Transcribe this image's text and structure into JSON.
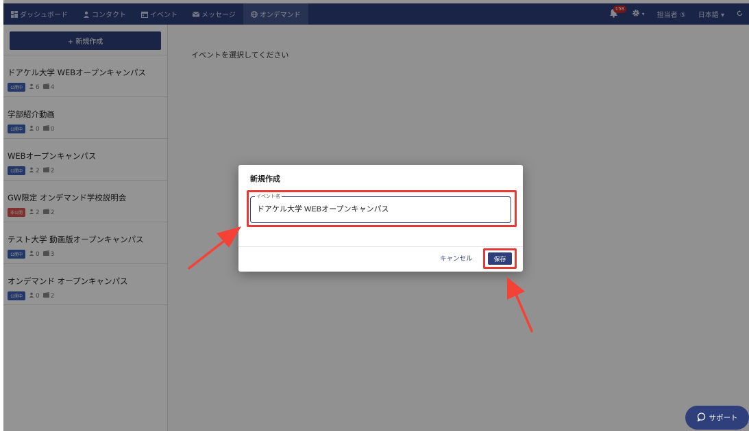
{
  "navbar": {
    "items": [
      {
        "label": "ダッシュボード",
        "icon": "dashboard-icon"
      },
      {
        "label": "コンタクト",
        "icon": "person-icon"
      },
      {
        "label": "イベント",
        "icon": "calendar-icon"
      },
      {
        "label": "メッセージ",
        "icon": "mail-icon"
      },
      {
        "label": "オンデマンド",
        "icon": "globe-icon",
        "active": true
      }
    ],
    "notification_count": "158",
    "settings_caret": "▾",
    "assignee_label": "担当者 ⑤",
    "language_label": "日本語 ▾"
  },
  "sidebar": {
    "new_button_label": "+ 新規作成",
    "items": [
      {
        "title": "ドアケル大学 WEBオープンキャンパス",
        "status": "公開中",
        "people": "6",
        "videos": "4"
      },
      {
        "title": "学部紹介動画",
        "status": "公開中",
        "people": "0",
        "videos": "0"
      },
      {
        "title": "WEBオープンキャンパス",
        "status": "公開中",
        "people": "2",
        "videos": "2"
      },
      {
        "title": "GW限定 オンデマンド学校説明会",
        "status": "非公開",
        "people": "2",
        "videos": "2"
      },
      {
        "title": "テスト大学 動画版オープンキャンパス",
        "status": "公開中",
        "people": "0",
        "videos": "3"
      },
      {
        "title": "オンデマンド オープンキャンパス",
        "status": "公開中",
        "people": "0",
        "videos": "2"
      }
    ]
  },
  "main": {
    "placeholder_text": "イベントを選択してください"
  },
  "dialog": {
    "title": "新規作成",
    "field_label": "イベント名",
    "field_value": "ドアケル大学 WEBオープンキャンパス",
    "cancel_label": "キャンセル",
    "save_label": "保存"
  },
  "support": {
    "label": "サポート"
  },
  "colors": {
    "navbar": "#2e3f7b",
    "primary": "#2e3f7b",
    "highlight": "#e53935",
    "badge_public": "#3f5fb5",
    "badge_private": "#d9534f"
  }
}
